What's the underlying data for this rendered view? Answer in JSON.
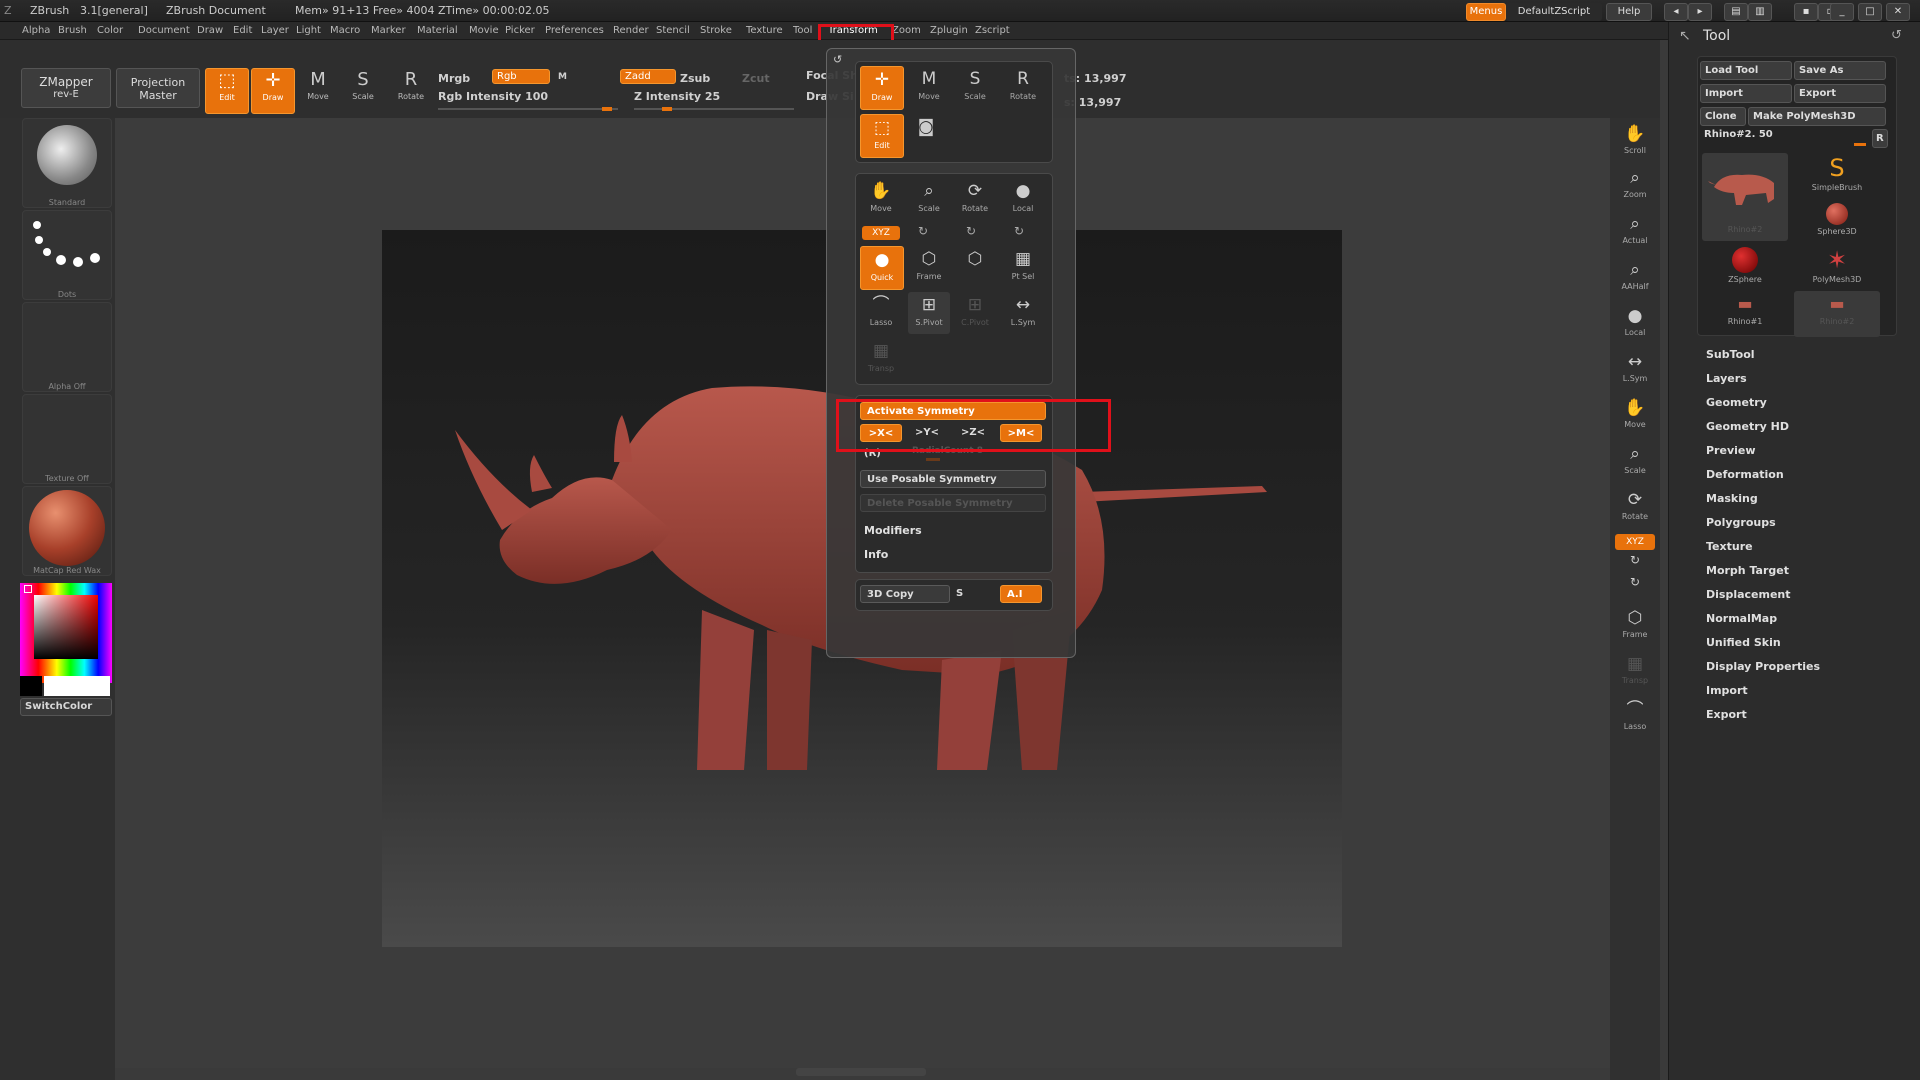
{
  "titlebar": {
    "app": "ZBrush",
    "version": "3.1[general]",
    "document": "ZBrush Document",
    "mem": "Mem» 91+13 Free» 4004 ZTime» 00:00:02.05",
    "menus_btn": "Menus",
    "script": "DefaultZScript",
    "help": "Help"
  },
  "menubar": [
    "Alpha",
    "Brush",
    "Color",
    "Document",
    "Draw",
    "Edit",
    "Layer",
    "Light",
    "Macro",
    "Marker",
    "Material",
    "Movie",
    "Picker",
    "Preferences",
    "Render",
    "Stencil",
    "Stroke",
    "Texture",
    "Tool",
    "Transform",
    "Zoom",
    "Zplugin",
    "Zscript"
  ],
  "toolbar": {
    "zmapper": "ZMapper",
    "zmapper_sub": "rev-E",
    "projection": "Projection",
    "projection_sub": "Master",
    "edit": "Edit",
    "draw": "Draw",
    "move": "Move",
    "scale": "Scale",
    "rotate": "Rotate",
    "mrgb": "Mrgb",
    "rgb": "Rgb",
    "m": "M",
    "rgb_intensity": "Rgb Intensity 100",
    "zadd": "Zadd",
    "zsub": "Zsub",
    "zcut": "Zcut",
    "z_intensity": "Z Intensity 25",
    "focal": "Focal Sh",
    "draw_size": "Draw Si",
    "points": "ts: 13,997",
    "points2": "s: 13,997"
  },
  "leftshelf": {
    "standard": "Standard",
    "dots": "Dots",
    "alpha": "Alpha Off",
    "texture": "Texture Off",
    "material": "MatCap Red Wax",
    "switchcolor": "SwitchColor"
  },
  "rightshelf": [
    "Scroll",
    "Zoom",
    "Actual",
    "AAHalf",
    "Local",
    "L.Sym",
    "Move",
    "Scale",
    "Rotate",
    "XYZ",
    "",
    "",
    "Frame",
    "Transp",
    "Lasso"
  ],
  "toolpanel": {
    "title": "Tool",
    "load": "Load Tool",
    "save": "Save As",
    "import": "Import",
    "export": "Export",
    "clone": "Clone",
    "make": "Make PolyMesh3D",
    "slider": "Rhino#2. 50",
    "r": "R",
    "tools": [
      "Rhino#2",
      "SimpleBrush",
      "Sphere3D",
      "ZSphere",
      "PolyMesh3D",
      "Rhino#1",
      "Rhino#2"
    ],
    "sections": [
      "SubTool",
      "Layers",
      "Geometry",
      "Geometry HD",
      "Preview",
      "Deformation",
      "Masking",
      "Polygroups",
      "Texture",
      "Morph Target",
      "Displacement",
      "NormalMap",
      "Unified Skin",
      "Display Properties",
      "Import",
      "Export"
    ]
  },
  "popup": {
    "draw": "Draw",
    "move": "Move",
    "scale": "Scale",
    "rotate": "Rotate",
    "edit": "Edit",
    "g2": [
      "Move",
      "Scale",
      "Rotate",
      "Local"
    ],
    "xyz": "XYZ",
    "quick": "Quick",
    "frame": "Frame",
    "ptsel": "Pt Sel",
    "lasso": "Lasso",
    "spivot": "S.Pivot",
    "cpivot": "C.Pivot",
    "lsym": "L.Sym",
    "transp": "Transp",
    "activate_symmetry": "Activate Symmetry",
    "x": ">X<",
    "y": ">Y<",
    "z": ">Z<",
    "m": ">M<",
    "r": "(R)",
    "radial": "RadialCount 8",
    "use_posable": "Use Posable Symmetry",
    "delete_posable": "Delete Posable Symmetry",
    "modifiers": "Modifiers",
    "info": "Info",
    "copy3d": "3D Copy",
    "s": "S",
    "ai": "A.I"
  },
  "colors": {
    "accent": "#e8720c",
    "highlight": "#e0101a",
    "model": "#a84a40"
  }
}
